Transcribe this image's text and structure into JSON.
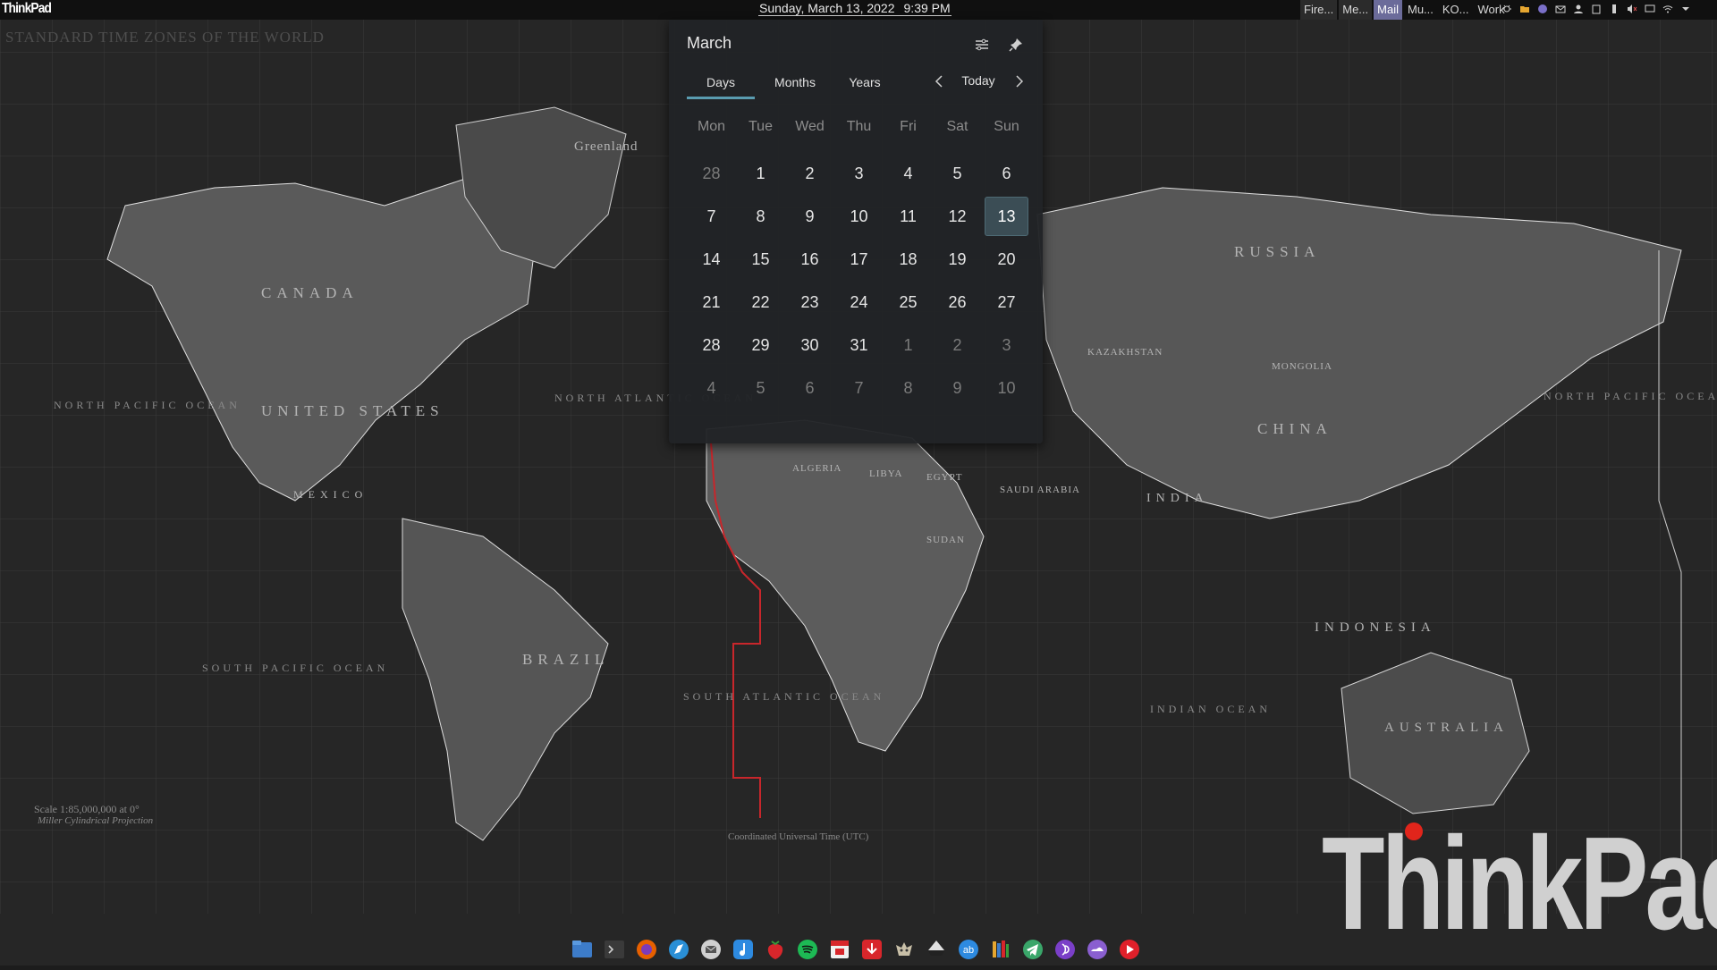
{
  "panel": {
    "logo": "ThinkPad",
    "clock": {
      "date": "Sunday, March 13, 2022",
      "time": "9:39 PM"
    },
    "tasks": [
      {
        "label": "Fire...",
        "state": "inactive",
        "icon": "firefox-icon"
      },
      {
        "label": "Me...",
        "state": "inactive",
        "icon": "messenger-icon"
      },
      {
        "label": "Mail",
        "state": "active",
        "icon": "mail-icon"
      },
      {
        "label": "Mu...",
        "state": "normal",
        "icon": "music-icon"
      },
      {
        "label": "KO...",
        "state": "normal",
        "icon": "ko-icon"
      },
      {
        "label": "Work",
        "state": "normal",
        "icon": "workspace-icon"
      }
    ],
    "tray": [
      "bug-icon",
      "folder-icon",
      "vpn-icon",
      "mail-notify-icon",
      "user-icon",
      "clipboard-icon",
      "battery-icon",
      "volume-muted-icon",
      "display-icon",
      "wifi-icon",
      "expand-arrow-icon"
    ]
  },
  "calendar": {
    "month": "March",
    "tabs": [
      "Days",
      "Months",
      "Years"
    ],
    "active_tab": "Days",
    "today_label": "Today",
    "weekdays": [
      "Mon",
      "Tue",
      "Wed",
      "Thu",
      "Fri",
      "Sat",
      "Sun"
    ],
    "weeks": [
      [
        {
          "d": "28",
          "other": true
        },
        {
          "d": "1"
        },
        {
          "d": "2"
        },
        {
          "d": "3"
        },
        {
          "d": "4"
        },
        {
          "d": "5"
        },
        {
          "d": "6"
        }
      ],
      [
        {
          "d": "7"
        },
        {
          "d": "8"
        },
        {
          "d": "9"
        },
        {
          "d": "10"
        },
        {
          "d": "11"
        },
        {
          "d": "12"
        },
        {
          "d": "13",
          "today": true
        }
      ],
      [
        {
          "d": "14"
        },
        {
          "d": "15"
        },
        {
          "d": "16"
        },
        {
          "d": "17"
        },
        {
          "d": "18"
        },
        {
          "d": "19"
        },
        {
          "d": "20"
        }
      ],
      [
        {
          "d": "21"
        },
        {
          "d": "22"
        },
        {
          "d": "23"
        },
        {
          "d": "24"
        },
        {
          "d": "25"
        },
        {
          "d": "26"
        },
        {
          "d": "27"
        }
      ],
      [
        {
          "d": "28"
        },
        {
          "d": "29"
        },
        {
          "d": "30"
        },
        {
          "d": "31"
        },
        {
          "d": "1",
          "other": true
        },
        {
          "d": "2",
          "other": true
        },
        {
          "d": "3",
          "other": true
        }
      ],
      [
        {
          "d": "4",
          "other": true
        },
        {
          "d": "5",
          "other": true
        },
        {
          "d": "6",
          "other": true
        },
        {
          "d": "7",
          "other": true
        },
        {
          "d": "8",
          "other": true
        },
        {
          "d": "9",
          "other": true
        },
        {
          "d": "10",
          "other": true
        }
      ]
    ]
  },
  "wallpaper": {
    "title": "STANDARD TIME ZONES OF THE WORLD",
    "brand": "ThinkPad",
    "countries": [
      "CANADA",
      "UNITED STATES",
      "MEXICO",
      "BRAZIL",
      "RUSSIA",
      "CHINA",
      "MONGOLIA",
      "KAZAKHSTAN",
      "INDIA",
      "INDONESIA",
      "AUSTRALIA",
      "ALGERIA",
      "LIBYA",
      "EGYPT",
      "SUDAN",
      "SAUDI ARABIA",
      "Greenland"
    ],
    "oceans": [
      "NORTH PACIFIC OCEAN",
      "SOUTH PACIFIC OCEAN",
      "NORTH ATLANTIC OCEAN",
      "SOUTH ATLANTIC OCEAN",
      "INDIAN OCEAN",
      "NORTH PACIFIC OCEAN"
    ],
    "scale": "Scale 1:85,000,000 at 0°",
    "projection": "Miller Cylindrical Projection",
    "utc_note": "Coordinated Universal Time (UTC)"
  },
  "dock": [
    "file-manager-icon",
    "terminal-icon",
    "firefox-icon",
    "browser-icon",
    "mail-icon",
    "music-app-icon",
    "strawberry-icon",
    "spotify-icon",
    "calendar-app-icon",
    "download-icon",
    "game-icon",
    "inkscape-icon",
    "accessibility-icon",
    "library-icon",
    "telegram-icon",
    "podcast-icon",
    "weather-icon",
    "youtube-icon"
  ]
}
